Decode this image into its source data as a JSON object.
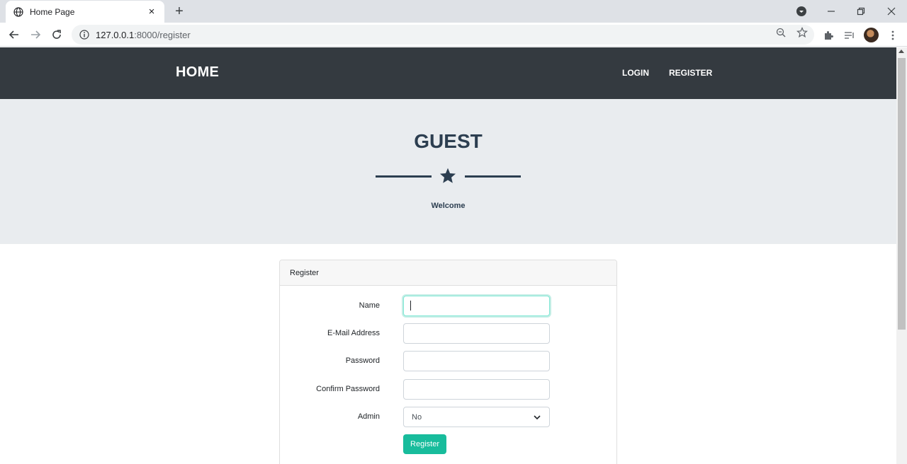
{
  "browser": {
    "tab_title": "Home Page",
    "tab_close": "×",
    "new_tab": "+",
    "url_host": "127.0.0.1",
    "url_path": ":8000/register"
  },
  "navbar": {
    "brand": "HOME",
    "links": [
      "LOGIN",
      "REGISTER"
    ]
  },
  "masthead": {
    "title": "GUEST",
    "subtitle": "Welcome"
  },
  "card": {
    "header": "Register",
    "fields": [
      {
        "label": "Name",
        "value": ""
      },
      {
        "label": "E-Mail Address",
        "value": ""
      },
      {
        "label": "Password",
        "value": ""
      },
      {
        "label": "Confirm Password",
        "value": ""
      }
    ],
    "admin_label": "Admin",
    "admin_value": "No",
    "submit_label": "Register"
  },
  "colors": {
    "navbar_bg": "#343a40",
    "masthead_bg": "#e9ecef",
    "primary": "#2c3e50",
    "accent": "#18bc9c"
  }
}
